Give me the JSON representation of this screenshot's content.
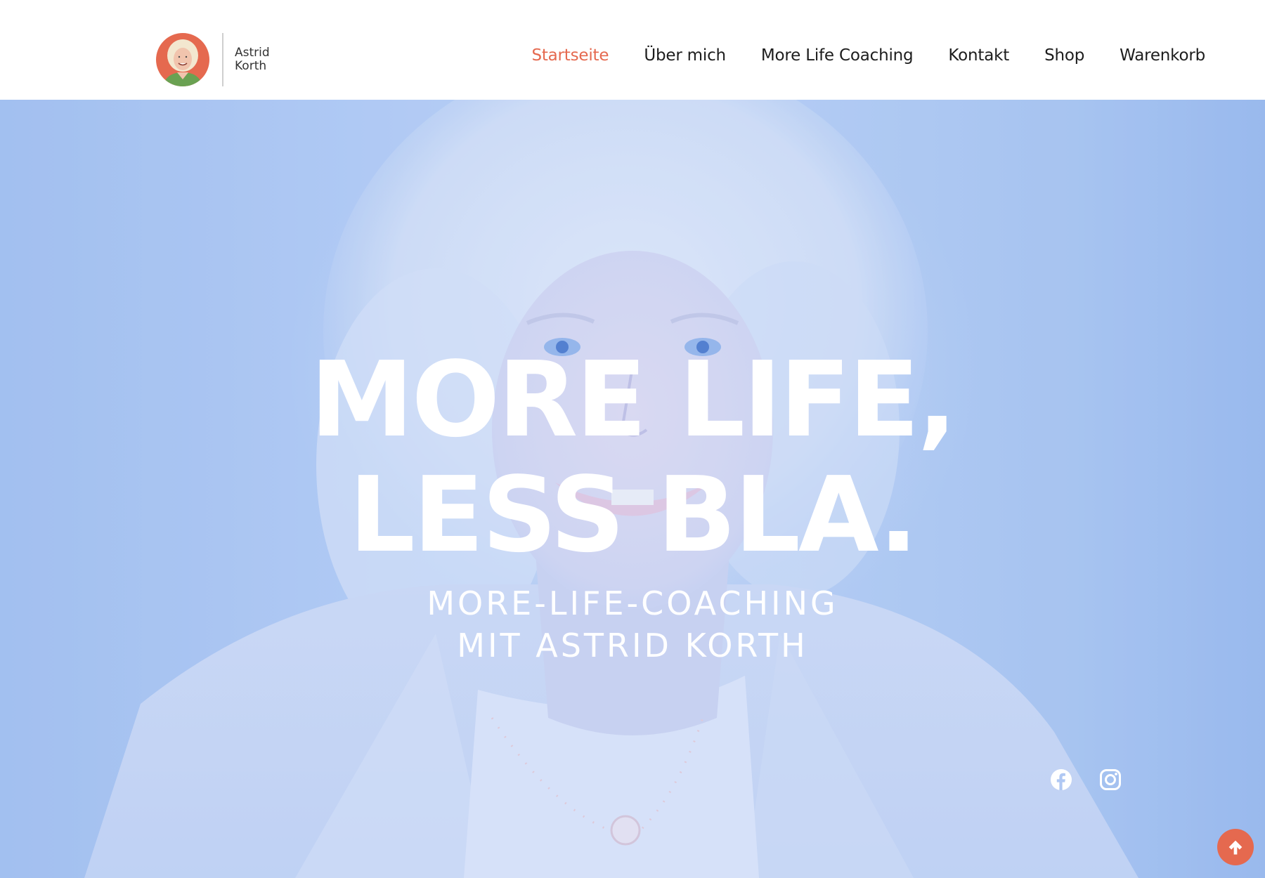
{
  "logo": {
    "first_name": "Astrid",
    "last_name": "Korth"
  },
  "nav": {
    "items": [
      {
        "label": "Startseite",
        "active": true
      },
      {
        "label": "Über mich",
        "active": false
      },
      {
        "label": "More Life Coaching",
        "active": false
      },
      {
        "label": "Kontakt",
        "active": false
      },
      {
        "label": "Shop",
        "active": false
      },
      {
        "label": "Warenkorb",
        "active": false
      }
    ]
  },
  "hero": {
    "title_line1": "MORE LIFE,",
    "title_line2": "LESS BLA.",
    "subtitle_line1": "MORE-LIFE-COACHING",
    "subtitle_line2": "MIT ASTRID KORTH"
  },
  "social": {
    "icons": [
      "facebook-icon",
      "instagram-icon"
    ]
  },
  "scroll_top": {
    "icon": "arrow-up-icon"
  },
  "colors": {
    "accent": "#e5694f",
    "hero_blue": "#b3cbf5",
    "text_dark": "#1d1d1d"
  }
}
